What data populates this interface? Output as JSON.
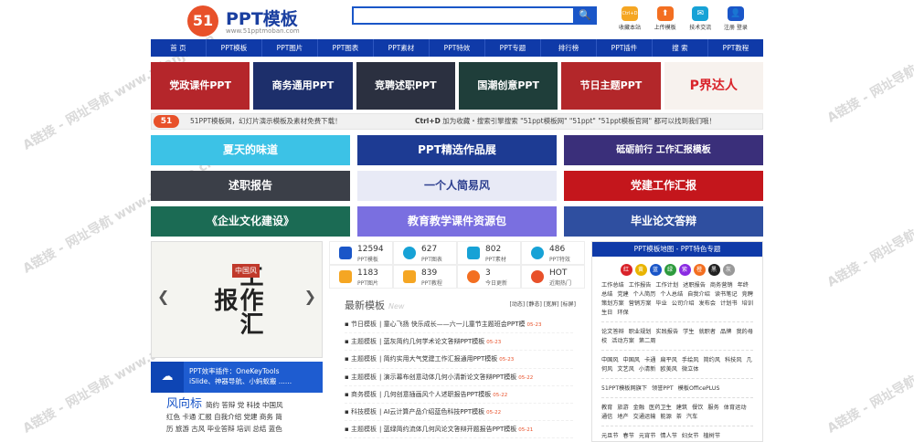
{
  "logo": {
    "mark": "51",
    "name": "PPT模板",
    "site": "www.51pptmoban.com"
  },
  "search": {
    "placeholder": "",
    "button": "🔍"
  },
  "header_icons": [
    {
      "label": "收藏本站",
      "text": "Ctrl+D",
      "color": "#f5a623"
    },
    {
      "label": "上传模板",
      "text": "⬆",
      "color": "#f36f21"
    },
    {
      "label": "技术交流",
      "text": "✉",
      "color": "#17a2d6"
    },
    {
      "label": "注册 登录",
      "text": "👤",
      "color": "#1a56c8"
    }
  ],
  "nav": [
    "首 页",
    "PPT模板",
    "PPT图片",
    "PPT图表",
    "PPT素材",
    "PPT特效",
    "PPT专题",
    "排行榜",
    "PPT插件",
    "搜 索",
    "PPT教程"
  ],
  "hot_banners": [
    {
      "label": "党政课件PPT",
      "color": "#b5262b"
    },
    {
      "label": "商务通用PPT",
      "color": "#1d2f6b"
    },
    {
      "label": "竞聘述职PPT",
      "color": "#2b3040"
    },
    {
      "label": "国潮创意PPT",
      "color": "#1f3e3a"
    },
    {
      "label": "节日主题PPT",
      "color": "#b3272a"
    },
    {
      "label": "P界达人",
      "color": "#f7f2ee"
    }
  ],
  "notice": {
    "left": "51PPT模板网，幻灯片演示模板及素材免费下载！",
    "right_prefix": "Ctrl+D",
    "right": " 加为收藏・搜索引擎搜索 \"51ppt模板网\" \"51ppt\" \"51ppt模板官网\" 都可以找到我们哦！"
  },
  "ads": [
    {
      "label": "夏天的味道",
      "color": "#3cc2e6"
    },
    {
      "label": "PPT精选作品展",
      "color": "#1d3b93"
    },
    {
      "label": "砥砺前行 工作汇报模板",
      "color": "#3a2f7a"
    },
    {
      "label": "述职报告",
      "color": "#3b3f48"
    },
    {
      "label": "一个人简易风",
      "color": "#e8eaf6"
    },
    {
      "label": "党建工作汇报",
      "color": "#c4161c"
    },
    {
      "label": "《企业文化建设》",
      "color": "#1b6b54"
    },
    {
      "label": "教育教学课件资源包",
      "color": "#7a6fe0"
    },
    {
      "label": "毕业论文答辩",
      "color": "#2f4fa0"
    }
  ],
  "slide": {
    "title": "工作汇报",
    "badge": "中国风"
  },
  "tool": {
    "line1": "PPT效率插件：OneKeyTools",
    "line2": "iSlide、神器导航、小蚂蚁搬 ......"
  },
  "style_block": {
    "title": "风向标",
    "line1": "简约 答辩 党 科技 中国风",
    "line2": "红色 卡通 汇报 自我介绍 党建 商务 简",
    "line3": "历 旅游 古风 毕业答辩 培训 总结 蓝色"
  },
  "stats": [
    {
      "num": "12594",
      "label": "PPT模板",
      "color": "#1a56c8"
    },
    {
      "num": "627",
      "label": "PPT图表",
      "color": "#17a2d6"
    },
    {
      "num": "802",
      "label": "PPT素材",
      "color": "#17a2d6"
    },
    {
      "num": "486",
      "label": "PPT特效",
      "color": "#17a2d6"
    },
    {
      "num": "1183",
      "label": "PPT图片",
      "color": "#f5a623"
    },
    {
      "num": "839",
      "label": "PPT教程",
      "color": "#f5a623"
    },
    {
      "num": "3",
      "label": "今日更新",
      "color": "#f36f21"
    },
    {
      "num": "HOT",
      "label": "近期热门",
      "color": "#e8512a"
    }
  ],
  "latest": {
    "title": "最新模板",
    "en": "New",
    "filters": "[动态] [静态] [宽屏] [标屏]",
    "items": [
      {
        "cat": "节日模板",
        "text": "童心飞扬 快乐成长——六一儿童节主题班会PPT模",
        "date": "05-23"
      },
      {
        "cat": "主题模板",
        "text": "蓝灰简约几何学术论文答辩PPT模板",
        "date": "05-23"
      },
      {
        "cat": "主题模板",
        "text": "简约实用大气党建工作汇报通用PPT模板",
        "date": "05-23"
      },
      {
        "cat": "主题模板",
        "text": "演示幕布创意动体几何小清新论文答辩PPT模板",
        "date": "05-22"
      },
      {
        "cat": "商务模板",
        "text": "几何创意插画风个人述职报告PPT模板",
        "date": "05-22"
      },
      {
        "cat": "科技模板",
        "text": "AI云计算产品介绍蓝色科技PPT模板",
        "date": "05-22"
      },
      {
        "cat": "主题模板",
        "text": "蓝绿简约流体几何风论文答辩开题报告PPT模板",
        "date": "05-21"
      }
    ]
  },
  "sidebar": {
    "title": "PPT模板地图 - PPT特色专题",
    "colors": [
      {
        "label": "红",
        "color": "#d9232a"
      },
      {
        "label": "黄",
        "color": "#e9b400"
      },
      {
        "label": "蓝",
        "color": "#1a56c8"
      },
      {
        "label": "绿",
        "color": "#2e9b3e"
      },
      {
        "label": "紫",
        "color": "#8a2be2"
      },
      {
        "label": "橙",
        "color": "#f36f21"
      },
      {
        "label": "黑",
        "color": "#222222"
      },
      {
        "label": "灰",
        "color": "#999999"
      }
    ],
    "block1": "工作总结 工作报告 工作计划 述职报告 商务营销 年终总结 党建 个人简历 个人总结 自我介绍 读书笔记 竞聘 策划方案 营销方案 毕业 公司介绍 发布会 计划书 培训 生日 环保",
    "block2": "论文答辩 职业规划 实践报告 学生 就职者 品牌 我的母校 活动方案 第二周",
    "block3": "中国风 中国风 卡通 扁平风 手绘风 简约风 科技风 几何风 文艺风 小清新 欧美风 微立体",
    "block4": "51PPT模板网旗下 领誉PPT 模板OfficePLUS",
    "block5": "教育 旅游 金融 医药卫生 建筑 餐饮 服务 体育运动 通信 地产 交通运输 能源 茶 汽车",
    "block6": "元旦节 春节 元宵节 情人节 妇女节 植树节"
  },
  "watermark": "A链接 - 网址导航 www.alianjie.cn"
}
